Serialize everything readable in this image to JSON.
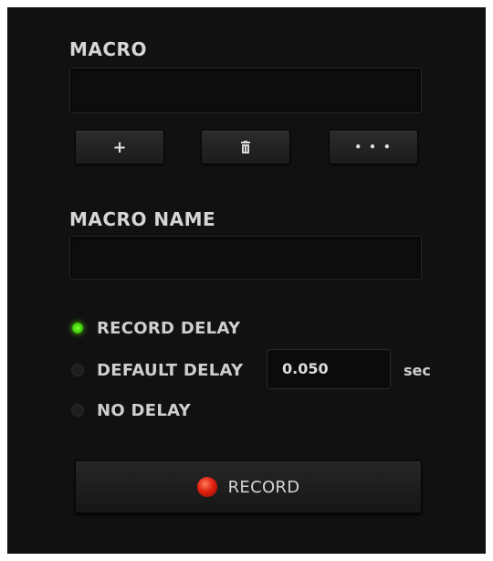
{
  "macro_section": {
    "label": "MACRO",
    "value": "",
    "buttons": {
      "add_label": "+",
      "more_label": "• • •"
    }
  },
  "macro_name_section": {
    "label": "MACRO NAME",
    "value": ""
  },
  "delay_options": {
    "record_delay_label": "RECORD DELAY",
    "default_delay_label": "DEFAULT DELAY",
    "no_delay_label": "NO DELAY",
    "selected": "RECORD DELAY",
    "default_delay_value": "0.050",
    "default_delay_unit": "sec"
  },
  "record_button": {
    "label": "RECORD",
    "icon": "record-dot-icon"
  },
  "colors": {
    "panel_bg": "#111111",
    "selected_radio": "#44d10e",
    "record_dot": "#e02010"
  }
}
